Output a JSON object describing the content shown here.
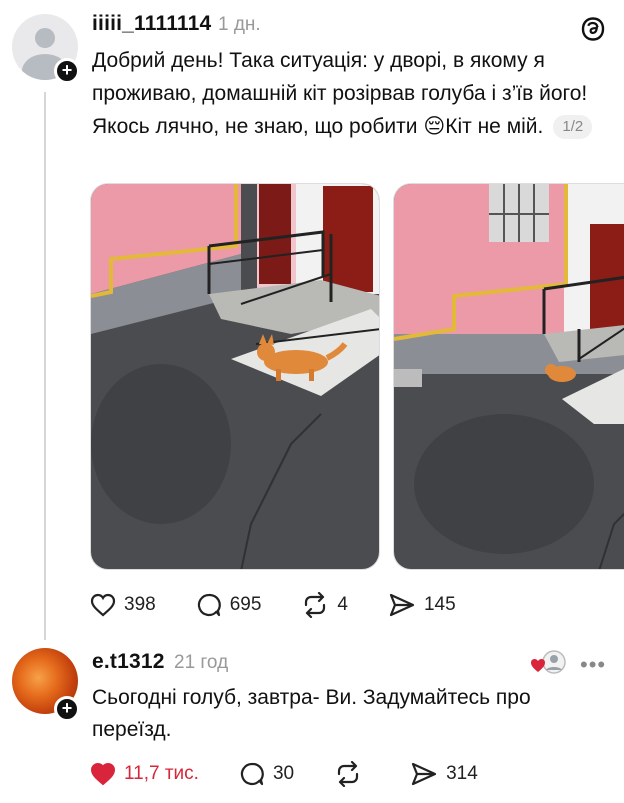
{
  "post": {
    "username": "iiiii_1111114",
    "time": "1 дн.",
    "text": "Добрий день! Така ситуація: у дворі, в якому я проживаю, домашній кіт розірвав голуба і з’їв його! Якось лячно, не знаю, що робити 😔Кіт не мій.",
    "pager": "1/2",
    "likes": "398",
    "comments": "695",
    "reposts": "4",
    "shares": "145"
  },
  "comment": {
    "username": "e.t1312",
    "time": "21 год",
    "text": "Сьогодні голуб, завтра- Ви. Задумайтесь про переїзд.",
    "likes": "11,7 тис.",
    "comments": "30",
    "shares": "314",
    "more_label": "•••"
  },
  "colors": {
    "like_red": "#d8253b",
    "wall_pink": "#ec9aa8",
    "asphalt": "#4a4c50",
    "cat_orange": "#e0893a"
  },
  "icons": [
    "threads-logo-icon",
    "heart-icon",
    "comment-icon",
    "repost-icon",
    "share-icon",
    "plus-icon",
    "more-icon"
  ]
}
